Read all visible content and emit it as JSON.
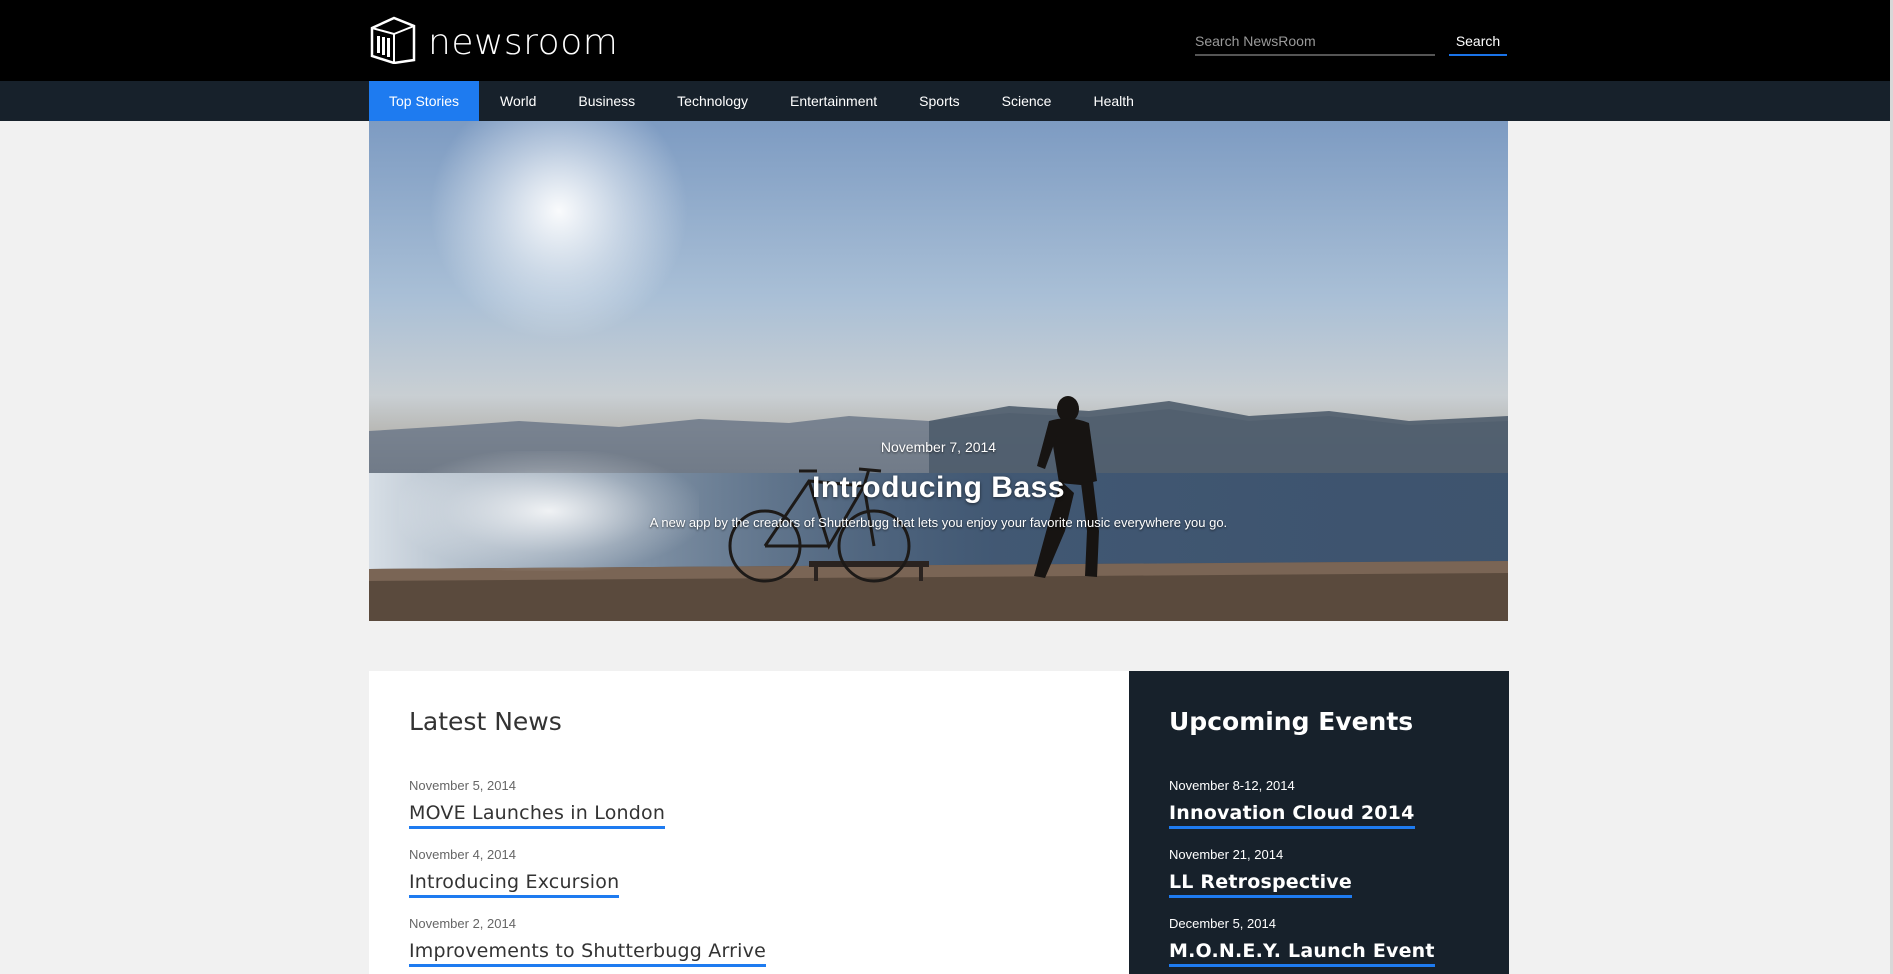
{
  "header": {
    "logo_text": "newsroom",
    "search_placeholder": "Search NewsRoom",
    "search_button": "Search"
  },
  "nav": {
    "items": [
      {
        "label": "Top Stories",
        "active": true
      },
      {
        "label": "World"
      },
      {
        "label": "Business"
      },
      {
        "label": "Technology"
      },
      {
        "label": "Entertainment"
      },
      {
        "label": "Sports"
      },
      {
        "label": "Science"
      },
      {
        "label": "Health"
      }
    ]
  },
  "hero": {
    "date": "November 7, 2014",
    "title": "Introducing Bass",
    "subtitle": "A new app by the creators of Shutterbugg that lets you enjoy your favorite music everywhere you go."
  },
  "latest_news": {
    "title": "Latest News",
    "items": [
      {
        "date": "November 5, 2014",
        "title": "MOVE Launches in London"
      },
      {
        "date": "November 4, 2014",
        "title": "Introducing Excursion"
      },
      {
        "date": "November 2, 2014",
        "title": "Improvements to Shutterbugg Arrive"
      }
    ]
  },
  "upcoming_events": {
    "title": "Upcoming Events",
    "items": [
      {
        "date": "November 8-12, 2014",
        "title": "Innovation Cloud 2014"
      },
      {
        "date": "November 21, 2014",
        "title": "LL Retrospective"
      },
      {
        "date": "December 5, 2014",
        "title": "M.O.N.E.Y. Launch Event"
      }
    ]
  },
  "colors": {
    "accent": "#1e7bf0",
    "header_bg": "#000000",
    "nav_bg": "#17212b",
    "page_bg": "#f1f1f1"
  }
}
